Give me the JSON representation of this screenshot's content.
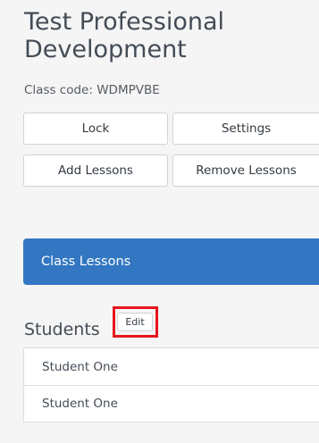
{
  "class_info": {
    "title": "Test Professional Development",
    "code_text": "Class code: WDMPVBE"
  },
  "actions": {
    "lock_label": "Lock",
    "settings_label": "Settings",
    "add_lessons_label": "Add Lessons",
    "remove_lessons_label": "Remove Lessons"
  },
  "lessons": {
    "label": "Class Lessons"
  },
  "students": {
    "heading": "Students",
    "edit_label": "Edit",
    "items": [
      {
        "name": "Student One"
      },
      {
        "name": "Student One"
      }
    ]
  },
  "colors": {
    "accent": "#3377c2",
    "highlight": "#e8141c",
    "background": "#f5f5f5"
  }
}
